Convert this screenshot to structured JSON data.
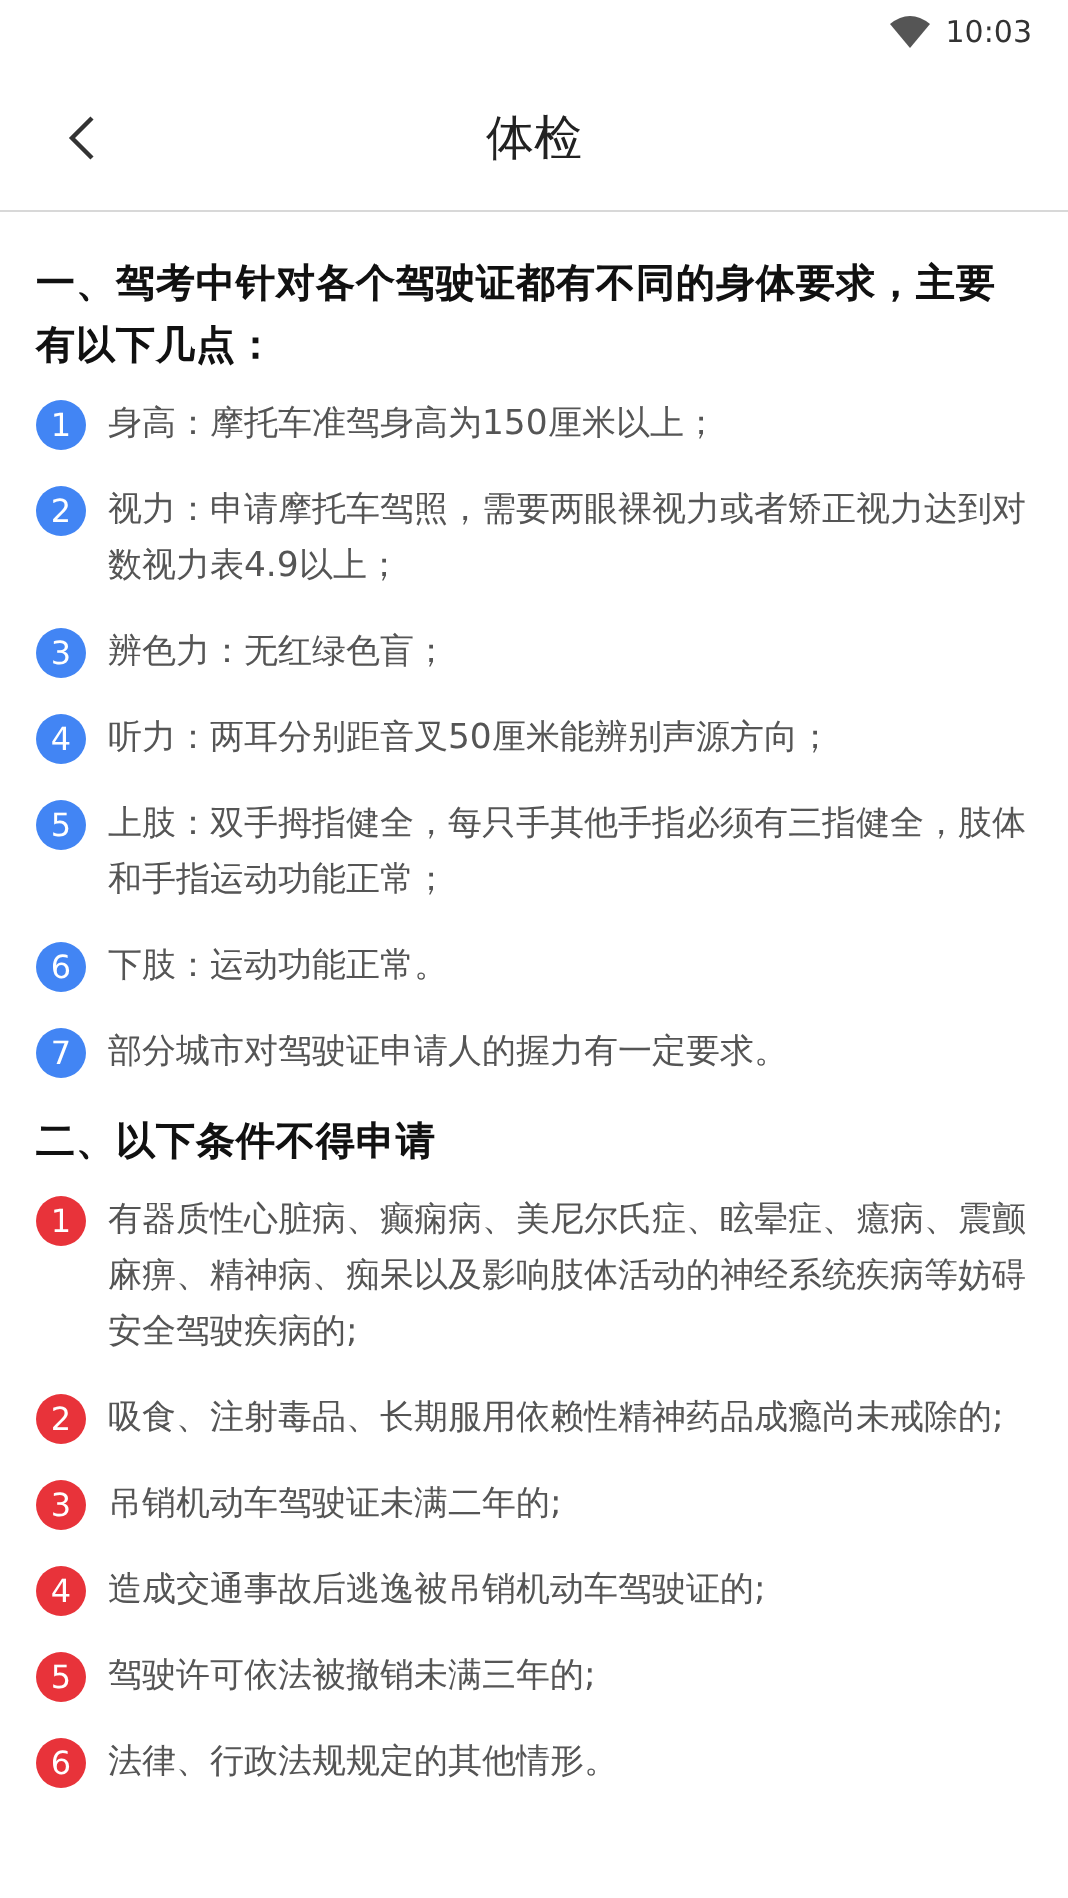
{
  "status_bar": {
    "time": "10:03"
  },
  "header": {
    "title": "体检"
  },
  "sections": [
    {
      "heading": "一、驾考中针对各个驾驶证都有不同的身体要求，主要有以下几点：",
      "color": "#4285f4",
      "items": [
        {
          "number": "1",
          "text": "身高：摩托车准驾身高为150厘米以上；"
        },
        {
          "number": "2",
          "text": "视力：申请摩托车驾照，需要两眼裸视力或者矫正视力达到对数视力表4.9以上；"
        },
        {
          "number": "3",
          "text": "辨色力：无红绿色盲；"
        },
        {
          "number": "4",
          "text": "听力：两耳分别距音叉50厘米能辨别声源方向；"
        },
        {
          "number": "5",
          "text": "上肢：双手拇指健全，每只手其他手指必须有三指健全，肢体和手指运动功能正常；"
        },
        {
          "number": "6",
          "text": "下肢：运动功能正常。"
        },
        {
          "number": "7",
          "text": "部分城市对驾驶证申请人的握力有一定要求。"
        }
      ]
    },
    {
      "heading": "二、以下条件不得申请",
      "color": "#e8333a",
      "items": [
        {
          "number": "1",
          "text": "有器质性心脏病、癫痫病、美尼尔氏症、眩晕症、癔病、震颤麻痹、精神病、痴呆以及影响肢体活动的神经系统疾病等妨碍安全驾驶疾病的;"
        },
        {
          "number": "2",
          "text": "吸食、注射毒品、长期服用依赖性精神药品成瘾尚未戒除的;"
        },
        {
          "number": "3",
          "text": "吊销机动车驾驶证未满二年的;"
        },
        {
          "number": "4",
          "text": "造成交通事故后逃逸被吊销机动车驾驶证的;"
        },
        {
          "number": "5",
          "text": "驾驶许可依法被撤销未满三年的;"
        },
        {
          "number": "6",
          "text": "法律、行政法规规定的其他情形。"
        }
      ]
    }
  ]
}
